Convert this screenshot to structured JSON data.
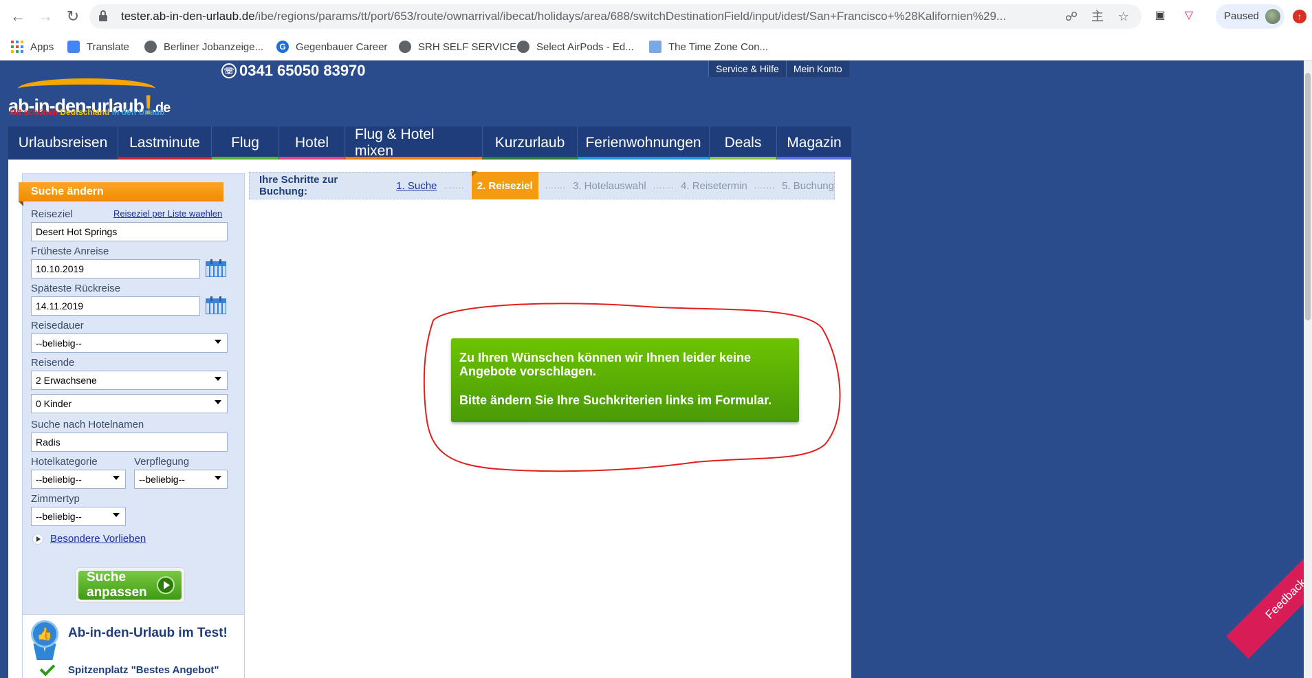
{
  "browser": {
    "url_host": "tester.ab-in-den-urlaub.de",
    "url_path": "/ibe/regions/params/tt/port/653/route/ownarrival/ibecat/holidays/area/688/switchDestinationField/input/idest/San+Francisco+%28Kalifornien%29...",
    "profile_status": "Paused",
    "bookmarks": [
      {
        "label": "Apps",
        "icon": "apps-grid-icon"
      },
      {
        "label": "Translate",
        "icon": "translate-icon"
      },
      {
        "label": "Berliner Jobanzeige...",
        "icon": "globe-icon"
      },
      {
        "label": "Gegenbauer Career",
        "icon": "g-logo-icon"
      },
      {
        "label": "SRH SELF SERVICE",
        "icon": "globe-icon"
      },
      {
        "label": "Select AirPods - Ed...",
        "icon": "globe-icon"
      },
      {
        "label": "The Time Zone Con...",
        "icon": "page-icon"
      }
    ]
  },
  "header": {
    "logo_text": "ab-in-den-urlaub",
    "logo_tld": ".de",
    "slogan_1": "Mit schönen",
    "slogan_2": "Deutschland",
    "slogan_3": "in den Urlaub",
    "phone": "0341 65050 83970",
    "top_links": [
      "Service & Hilfe",
      "Mein Konto"
    ]
  },
  "nav": [
    {
      "label": "Urlaubsreisen",
      "color": "#1e3d7a"
    },
    {
      "label": "Lastminute",
      "color": "#d0202d"
    },
    {
      "label": "Flug",
      "color": "#5ab131"
    },
    {
      "label": "Hotel",
      "color": "#e0457b"
    },
    {
      "label": "Flug & Hotel mixen",
      "color": "#f07c00"
    },
    {
      "label": "Kurzurlaub",
      "color": "#2e7d32"
    },
    {
      "label": "Ferienwohnungen",
      "color": "#1a9ad6"
    },
    {
      "label": "Deals",
      "color": "#8cc63f"
    },
    {
      "label": "Magazin",
      "color": "#5b6ee1"
    }
  ],
  "sidebar": {
    "title": "Suche ändern",
    "destination_label": "Reiseziel",
    "destination_list_link": "Reiseziel per Liste waehlen",
    "destination_value": "Desert Hot Springs",
    "departure_label": "Früheste Anreise",
    "departure_value": "10.10.2019",
    "return_label": "Späteste Rückreise",
    "return_value": "14.11.2019",
    "duration_label": "Reisedauer",
    "duration_value": "--beliebig--",
    "travellers_label": "Reisende",
    "adults_value": "2 Erwachsene",
    "children_value": "0 Kinder",
    "hotelname_label": "Suche nach Hotelnamen",
    "hotelname_value": "Radis",
    "category_label": "Hotelkategorie",
    "category_value": "--beliebig--",
    "board_label": "Verpflegung",
    "board_value": "--beliebig--",
    "room_label": "Zimmertyp",
    "room_value": "--beliebig--",
    "preferences_link": "Besondere Vorlieben",
    "search_button": "Suche anpassen",
    "test_title": "Ab-in-den-Urlaub im Test!",
    "test_item": "Spitzenplatz \"Bestes Angebot\""
  },
  "steps": {
    "intro": "Ihre Schritte zur Buchung:",
    "items": [
      "1. Suche",
      "2. Reiseziel",
      "3. Hotelauswahl",
      "4. Reisetermin",
      "5. Buchung"
    ],
    "dots": "......."
  },
  "message": {
    "line1": "Zu Ihren Wünschen können wir Ihnen leider keine Angebote vorschlagen.",
    "line2": "Bitte ändern Sie Ihre Suchkriterien links im Formular."
  },
  "feedback_label": "Feedback"
}
